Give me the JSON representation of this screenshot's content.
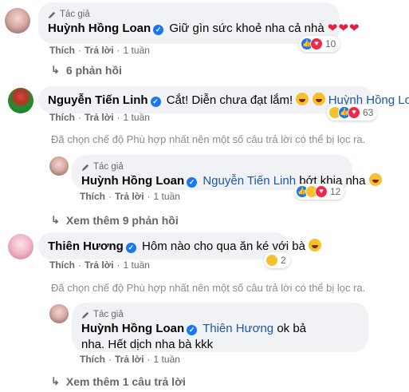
{
  "labels": {
    "author_tag": "Tác giả",
    "like": "Thích",
    "reply": "Trả lời",
    "time": "1 tuần"
  },
  "filter_note": "Đã chọn chế độ Phù hợp nhất nên một số câu trả lời có thể bị lọc ra.",
  "comments": [
    {
      "author": "Huỳnh Hồng Loan",
      "author_tag": true,
      "text": "Giữ gìn sức khoẻ nha cả nhà",
      "emoji": "❤❤❤",
      "reaction_count": "10",
      "reactions": [
        "like",
        "love"
      ],
      "more": "6 phản hồi"
    },
    {
      "author": "Nguyễn Tiến Linh",
      "text": "Cắt! Diễn chưa đạt lắm!",
      "mention": "Huỳnh Hồng Loan",
      "reaction_count": "63",
      "reactions": [
        "haha",
        "like",
        "love"
      ],
      "reply": {
        "author": "Huỳnh Hồng Loan",
        "mention": "Nguyễn Tiến Linh",
        "text": "bớt khịa nha",
        "reaction_count": "12",
        "reactions": [
          "like",
          "haha",
          "love"
        ]
      },
      "more": "Xem thêm 9 phản hồi"
    },
    {
      "author": "Thiên Hương",
      "text": "Hôm nào cho qua ăn ké với bà",
      "reaction_count": "2",
      "reactions": [
        "sad"
      ],
      "reply": {
        "author": "Huỳnh Hồng Loan",
        "mention": "Thiên Hương",
        "text": "ok bả nha. Hết dịch nha bà kkk"
      },
      "more": "Xem thêm 1 câu trả lời"
    }
  ]
}
